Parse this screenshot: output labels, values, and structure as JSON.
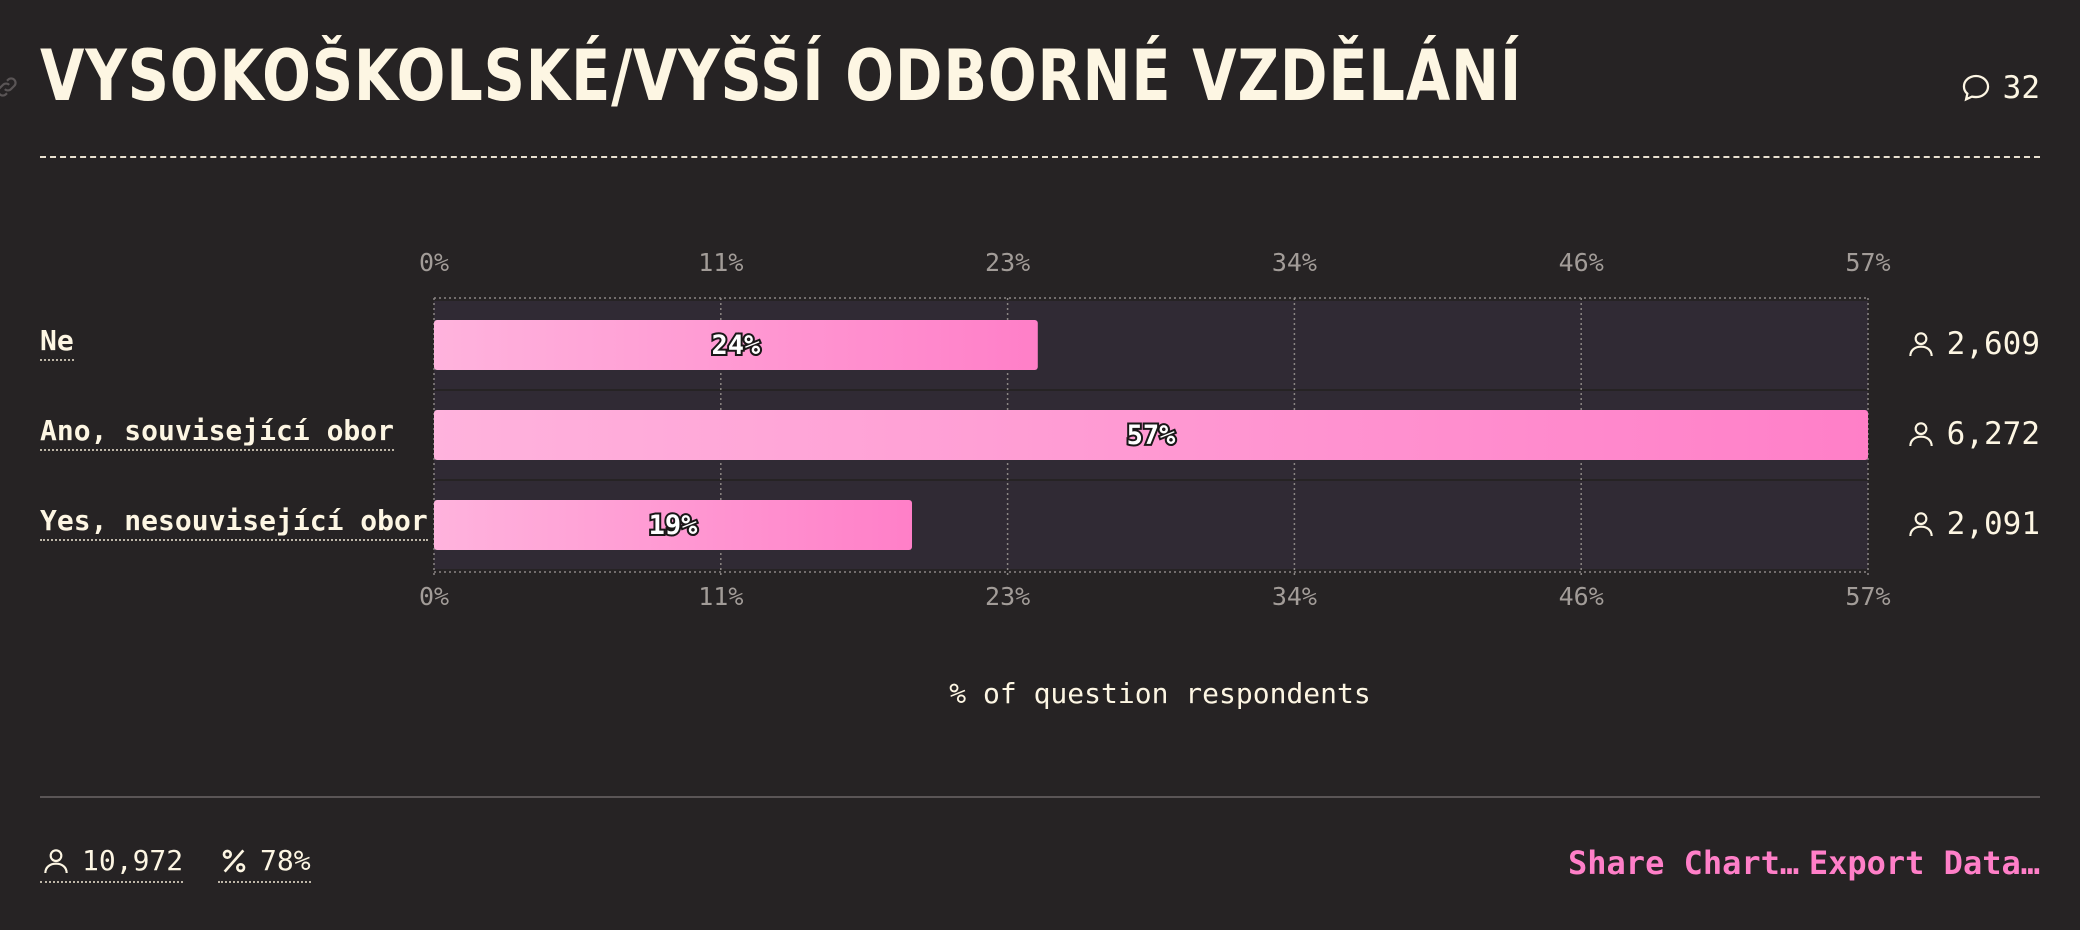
{
  "header": {
    "title": "VYSOKOŠKOLSKÉ/VYŠŠÍ ODBORNÉ VZDĚLÁNÍ",
    "comment_count": "32"
  },
  "chart_data": {
    "type": "bar",
    "orientation": "horizontal",
    "categories": [
      "Ne",
      "Ano, související obor",
      "Yes, nesouvisející obor"
    ],
    "values": [
      24,
      57,
      19
    ],
    "value_labels": [
      "24%",
      "57%",
      "19%"
    ],
    "respondent_counts": [
      "2,609",
      "6,272",
      "2,091"
    ],
    "xlabel": "% of question respondents",
    "ylabel": "",
    "xlim": [
      0,
      57
    ],
    "ticks": [
      0,
      11.4,
      22.8,
      34.2,
      45.6,
      57
    ],
    "tick_labels": [
      "0%",
      "11%",
      "23%",
      "34%",
      "46%",
      "57%"
    ],
    "grid": true,
    "colors": {
      "bar_start": "#ffb3dd",
      "bar_end": "#ff7fc8",
      "track": "#302a34",
      "grid": "#8a8583"
    }
  },
  "footer": {
    "total_respondents": "10,972",
    "response_rate": "78%",
    "share_label": "Share Chart…",
    "export_label": "Export Data…"
  },
  "icons": {
    "comment": "comment-icon",
    "person": "person-icon",
    "percent": "percent-icon",
    "link": "link-icon"
  }
}
